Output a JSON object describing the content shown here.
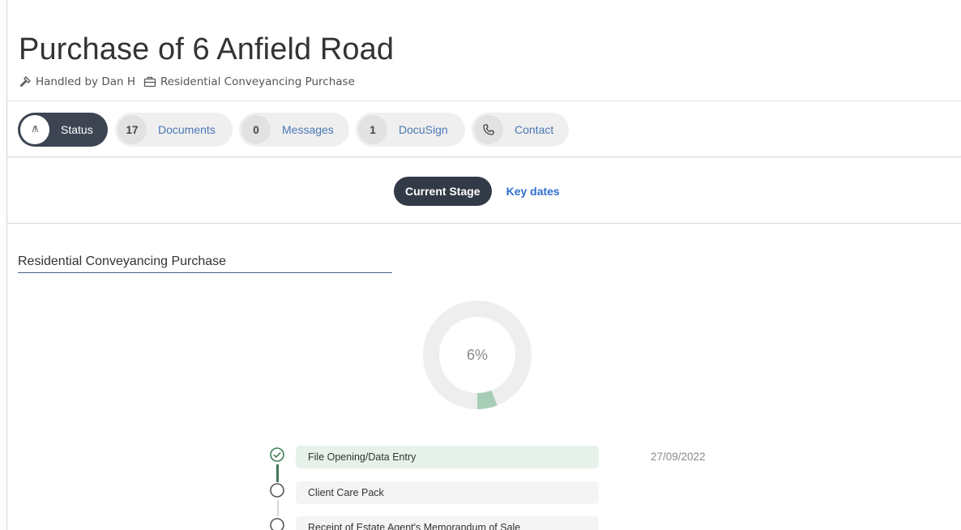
{
  "page": {
    "title": "Purchase of 6 Anfield Road",
    "handler": "Handled by Dan H",
    "matter_type": "Residential Conveyancing Purchase"
  },
  "tabs": [
    {
      "count": "/!\\",
      "label": "Status",
      "active": true,
      "icon": "road-icon"
    },
    {
      "count": "17",
      "label": "Documents"
    },
    {
      "count": "0",
      "label": "Messages"
    },
    {
      "count": "1",
      "label": "DocuSign"
    },
    {
      "count": "",
      "label": "Contact",
      "icon": "phone-icon"
    }
  ],
  "stage_toggle": {
    "current_stage": "Current Stage",
    "key_dates": "Key dates"
  },
  "progress": {
    "section_title": "Residential Conveyancing Purchase",
    "percent": 6,
    "percent_label": "6%"
  },
  "steps": [
    {
      "label": "File Opening/Data Entry",
      "status": "complete",
      "date": "27/09/2022"
    },
    {
      "label": "Client Care Pack",
      "status": "pending",
      "date": ""
    },
    {
      "label": "Receipt of Estate Agent's Memorandum of Sale",
      "status": "pending",
      "date": ""
    }
  ],
  "colors": {
    "active_pill": "#3d4553",
    "link": "#2f6fd1",
    "progress_fill": "#a8cdb6",
    "progress_track": "#eeeeee",
    "step_complete": "#3e7a55"
  }
}
